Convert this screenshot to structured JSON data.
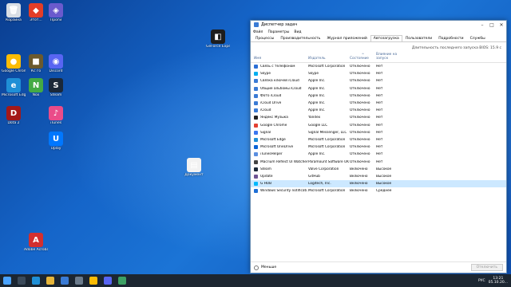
{
  "desktop": {
    "icons": [
      {
        "label": "Корзина",
        "color": "#d8dde4",
        "glyph": "🗑"
      },
      {
        "label": "Этот...",
        "color": "#e33d27",
        "glyph": "◆"
      },
      {
        "label": "Проги",
        "color": "#6a5acd",
        "glyph": "◈"
      },
      {
        "label": "Google Chrome",
        "color": "#fbbc05",
        "glyph": "●"
      },
      {
        "label": "Кс го",
        "color": "#6b5a2e",
        "glyph": "■"
      },
      {
        "label": "Discord",
        "color": "#5865f2",
        "glyph": "◉"
      },
      {
        "label": "Microsoft Edge",
        "color": "#1f8fd6",
        "glyph": "e"
      },
      {
        "label": "Nox",
        "color": "#44aa44",
        "glyph": "N"
      },
      {
        "label": "Steam",
        "color": "#1b2838",
        "glyph": "S"
      },
      {
        "label": "Dota 2",
        "color": "#a31818",
        "glyph": "D"
      },
      {
        "label": "iTunes",
        "color": "#ea4c89",
        "glyph": "♪"
      },
      {
        "label": "Uplay",
        "color": "#0077ff",
        "glyph": "U"
      },
      {
        "label": "Adobe Acrobat",
        "color": "#d32f2f",
        "glyph": "A"
      },
      {
        "label": "GeForce Experience",
        "color": "#1d1d1d",
        "glyph": "◧"
      },
      {
        "label": "Документ",
        "color": "#f2f2f2",
        "glyph": "▤"
      }
    ]
  },
  "task_manager": {
    "title": "Диспетчер задач",
    "window_controls": [
      "–",
      "□",
      "✕"
    ],
    "menu": [
      "Файл",
      "Параметры",
      "Вид"
    ],
    "tabs": [
      "Процессы",
      "Производительность",
      "Журнал приложений",
      "Автозагрузка",
      "Пользователи",
      "Подробности",
      "Службы"
    ],
    "active_tab": "Автозагрузка",
    "bios_label": "Длительность последнего запуска BIOS: 15.9 с",
    "sort_arrow": "^",
    "columns": {
      "name": "Имя",
      "publisher": "Издатель",
      "status": "Состояние",
      "impact": "Влияние на запуск"
    },
    "rows": [
      {
        "name": "Связь с телефоном",
        "publisher": "Microsoft Corporation",
        "status": "Отключено",
        "impact": "Нет",
        "color": "#2b6fd6"
      },
      {
        "name": "Skype",
        "publisher": "Skype",
        "status": "Отключено",
        "impact": "Нет",
        "color": "#00aff0"
      },
      {
        "name": "Связка ключей iCloud",
        "publisher": "Apple Inc.",
        "status": "Отключено",
        "impact": "Нет",
        "color": "#3a7bd5"
      },
      {
        "name": "Общие альбомы iCloud",
        "publisher": "Apple Inc.",
        "status": "Отключено",
        "impact": "Нет",
        "color": "#3a7bd5"
      },
      {
        "name": "Фото iCloud",
        "publisher": "Apple Inc.",
        "status": "Отключено",
        "impact": "Нет",
        "color": "#3a7bd5"
      },
      {
        "name": "iCloud Drive",
        "publisher": "Apple Inc.",
        "status": "Отключено",
        "impact": "Нет",
        "color": "#3a7bd5"
      },
      {
        "name": "iCloud",
        "publisher": "Apple Inc.",
        "status": "Отключено",
        "impact": "Нет",
        "color": "#3a7bd5"
      },
      {
        "name": "Яндекс Музыка",
        "publisher": "Yandex",
        "status": "Отключено",
        "impact": "Нет",
        "color": "#222222"
      },
      {
        "name": "Google Chrome",
        "publisher": "Google LLC",
        "status": "Отключено",
        "impact": "Нет",
        "color": "#e34133"
      },
      {
        "name": "Signal",
        "publisher": "Signal Messenger, LLC",
        "status": "Отключено",
        "impact": "Нет",
        "color": "#3a76f0"
      },
      {
        "name": "Microsoft Edge",
        "publisher": "Microsoft Corporation",
        "status": "Отключено",
        "impact": "Нет",
        "color": "#1f8fd6"
      },
      {
        "name": "Microsoft OneDrive",
        "publisher": "Microsoft Corporation",
        "status": "Отключено",
        "impact": "Нет",
        "color": "#0a64d6"
      },
      {
        "name": "iTunesHelper",
        "publisher": "Apple Inc.",
        "status": "Отключено",
        "impact": "Нет",
        "color": "#5a8fe0"
      },
      {
        "name": "Macrium Reflect UI Watcher",
        "publisher": "Paramount Software UK ...",
        "status": "Отключено",
        "impact": "Нет",
        "color": "#444444"
      },
      {
        "name": "Steam",
        "publisher": "Valve Corporation",
        "status": "Включено",
        "impact": "Высокое",
        "color": "#1b2838"
      },
      {
        "name": "Update",
        "publisher": "GitHub",
        "status": "Включено",
        "impact": "Высокое",
        "color": "#6e5494"
      },
      {
        "name": "G HUB",
        "publisher": "Logitech, Inc.",
        "status": "Включено",
        "impact": "Высокое",
        "color": "#00b8fc"
      },
      {
        "name": "Windows Security notificati...",
        "publisher": "Microsoft Corporation",
        "status": "Включено",
        "impact": "Среднее",
        "color": "#1f6fd6"
      }
    ],
    "selected_row": 16,
    "footer_less": "Меньше",
    "footer_disable": "Отключить"
  },
  "taskbar": {
    "icons": [
      {
        "name": "start",
        "color": "#4aa3ff"
      },
      {
        "name": "search",
        "color": "#3b4a5a"
      },
      {
        "name": "edge",
        "color": "#1f8fd6"
      },
      {
        "name": "explorer",
        "color": "#e6b53a"
      },
      {
        "name": "store",
        "color": "#3a7bd5"
      },
      {
        "name": "steam",
        "color": "#6b7b8c"
      },
      {
        "name": "chrome",
        "color": "#fbbc05"
      },
      {
        "name": "discord",
        "color": "#5865f2"
      },
      {
        "name": "taskmanager",
        "color": "#3ca063"
      }
    ],
    "language": "РУС",
    "time": "13:21",
    "date": "05.10.20..."
  }
}
